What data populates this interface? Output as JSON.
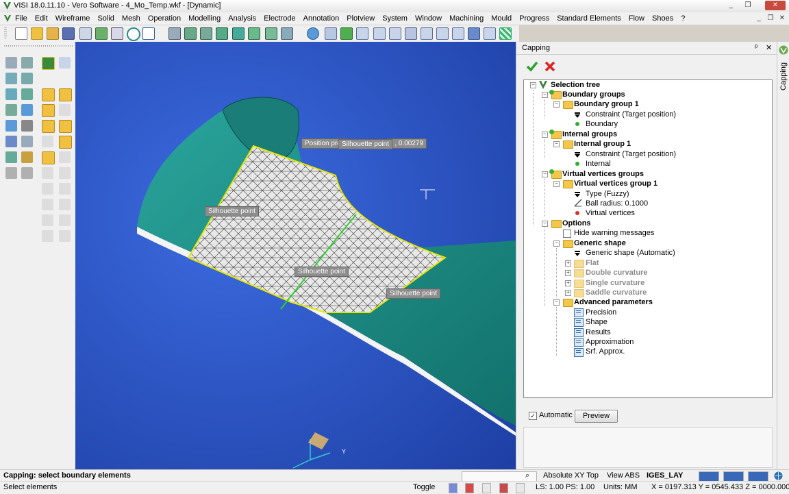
{
  "window": {
    "title": "VISI 18.0.11.10 - Vero Software - 4_Mo_Temp.wkf - [Dynamic]",
    "minimize": "_",
    "restore": "❐",
    "close": "✕",
    "inner_minimize": "_",
    "inner_restore": "❐",
    "inner_close": "✕"
  },
  "menu": [
    "File",
    "Edit",
    "Wireframe",
    "Solid",
    "Mesh",
    "Operation",
    "Modelling",
    "Analysis",
    "Electrode",
    "Annotation",
    "Plotview",
    "System",
    "Window",
    "Machining",
    "Mould",
    "Progress",
    "Standard Elements",
    "Flow",
    "Shoes",
    "?"
  ],
  "viewport": {
    "tooltips": {
      "top_left": "Position prec",
      "top_right": "d , 0.00279",
      "silhouette_1": "Silhouette point",
      "silhouette_2": "Silhouette point",
      "silhouette_3": "Silhouette point",
      "silhouette_4": "Silhouette point"
    },
    "axis_y": "Y",
    "colors": {
      "background": "#2b55c9",
      "body": "#1f8d86",
      "mesh": "#d8d8d8",
      "boundary": "#e6e600",
      "green_curve": "#2fd02f"
    }
  },
  "panel": {
    "title": "Capping",
    "pin": "ᵖ",
    "close": "✕",
    "ok_icon": "check-icon",
    "cancel_icon": "cross-icon",
    "tree": {
      "root": "Selection tree",
      "boundary_groups": "Boundary groups",
      "boundary_group_1": "Boundary group 1",
      "bg1_constraint": "Constraint (Target position)",
      "bg1_item": "Boundary",
      "internal_groups": "Internal groups",
      "internal_group_1": "Internal group 1",
      "ig1_constraint": "Constraint (Target position)",
      "ig1_item": "Internal",
      "vv_groups": "Virtual vertices groups",
      "vv_group_1": "Virtual vertices group 1",
      "vv_type": "Type (Fuzzy)",
      "vv_ball": "Ball radius: 0.1000",
      "vv_item": "Virtual vertices",
      "options": "Options",
      "hide_warnings": "Hide warning messages",
      "generic_shape": "Generic shape",
      "generic_shape_value": "Generic shape (Automatic)",
      "flat": "Flat",
      "double_curvature": "Double curvature",
      "single_curvature": "Single curvature",
      "saddle_curvature": "Saddle curvature",
      "advanced": "Advanced parameters",
      "precision": "Precision",
      "shape": "Shape",
      "results": "Results",
      "approximation": "Approximation",
      "srf_approx": "Srf. Approx."
    },
    "automatic_label": "Automatic",
    "automatic_checked": true,
    "preview_label": "Preview",
    "side_tab": "Capping"
  },
  "status": {
    "prompt": "Capping: select boundary elements",
    "select": "Select elements",
    "search_value": "",
    "view_mode": "Absolute XY Top",
    "view_abs": "View ABS",
    "layer": "IGES_LAY",
    "toggle": "Toggle",
    "ls_ps": "LS: 1.00 PS: 1.00",
    "units": "Units: MM",
    "coords": "X = 0197.313 Y = 0545.433 Z = 0000.000"
  }
}
